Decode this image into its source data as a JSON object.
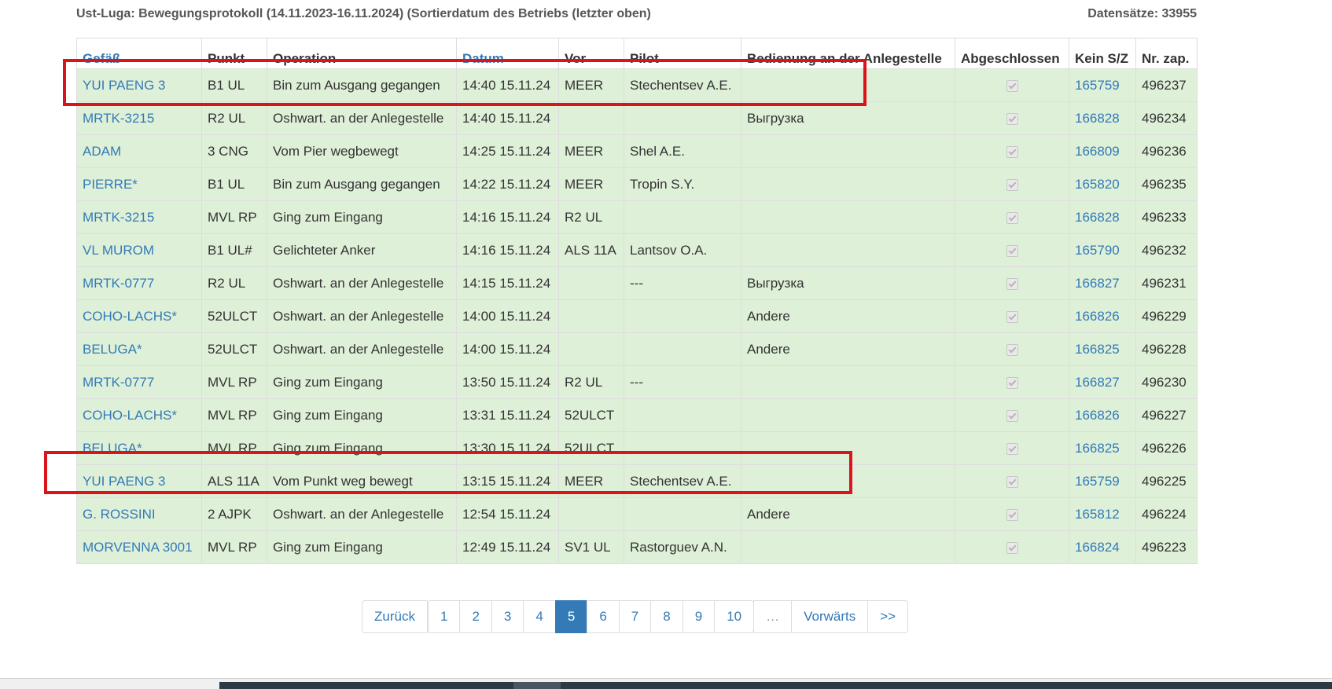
{
  "caption": {
    "title": "Ust-Luga: Bewegungsprotokoll (14.11.2023-16.11.2024) (Sortierdatum des Betriebs (letzter oben)",
    "count": "Datensätze: 33955"
  },
  "columns": {
    "vessel": "Gefäß",
    "point": "Punkt",
    "operation": "Operation",
    "date": "Datum",
    "from": "Vor",
    "pilot": "Pilot",
    "service": "Bedienung an der Anlegestelle",
    "completed": "Abgeschlossen",
    "sz": "Kein S/Z",
    "nr": "Nr. zap."
  },
  "rows": [
    {
      "vessel": "YUI PAENG 3",
      "point": "B1 UL",
      "operation": "Bin zum Ausgang gegangen",
      "date": "14:40 15.11.24",
      "from": "MEER",
      "pilot": "Stechentsev A.E.",
      "service": "",
      "sz": "165759",
      "nr": "496237"
    },
    {
      "vessel": "MRTK-3215",
      "point": "R2 UL",
      "operation": "Oshwart. an der Anlegestelle",
      "date": "14:40 15.11.24",
      "from": "",
      "pilot": "",
      "service": "Выгрузка",
      "sz": "166828",
      "nr": "496234"
    },
    {
      "vessel": "ADAM",
      "point": "3 CNG",
      "operation": "Vom Pier wegbewegt",
      "date": "14:25 15.11.24",
      "from": "MEER",
      "pilot": "Shel A.E.",
      "service": "",
      "sz": "166809",
      "nr": "496236"
    },
    {
      "vessel": "PIERRE*",
      "point": "B1 UL",
      "operation": "Bin zum Ausgang gegangen",
      "date": "14:22 15.11.24",
      "from": "MEER",
      "pilot": "Tropin S.Y.",
      "service": "",
      "sz": "165820",
      "nr": "496235"
    },
    {
      "vessel": "MRTK-3215",
      "point": "MVL RP",
      "operation": "Ging zum Eingang",
      "date": "14:16 15.11.24",
      "from": "R2 UL",
      "pilot": "",
      "service": "",
      "sz": "166828",
      "nr": "496233"
    },
    {
      "vessel": "VL MUROM",
      "point": "B1 UL#",
      "operation": "Gelichteter Anker",
      "date": "14:16 15.11.24",
      "from": "ALS 11A",
      "pilot": "Lantsov O.A.",
      "service": "",
      "sz": "165790",
      "nr": "496232"
    },
    {
      "vessel": "MRTK-0777",
      "point": "R2 UL",
      "operation": "Oshwart. an der Anlegestelle",
      "date": "14:15 15.11.24",
      "from": "",
      "pilot": "---",
      "service": "Выгрузка",
      "sz": "166827",
      "nr": "496231"
    },
    {
      "vessel": "COHO-LACHS*",
      "point": "52ULCT",
      "operation": "Oshwart. an der Anlegestelle",
      "date": "14:00 15.11.24",
      "from": "",
      "pilot": "",
      "service": "Andere",
      "sz": "166826",
      "nr": "496229"
    },
    {
      "vessel": "BELUGA*",
      "point": "52ULCT",
      "operation": "Oshwart. an der Anlegestelle",
      "date": "14:00 15.11.24",
      "from": "",
      "pilot": "",
      "service": "Andere",
      "sz": "166825",
      "nr": "496228"
    },
    {
      "vessel": "MRTK-0777",
      "point": "MVL RP",
      "operation": "Ging zum Eingang",
      "date": "13:50 15.11.24",
      "from": "R2 UL",
      "pilot": "---",
      "service": "",
      "sz": "166827",
      "nr": "496230"
    },
    {
      "vessel": "COHO-LACHS*",
      "point": "MVL RP",
      "operation": "Ging zum Eingang",
      "date": "13:31 15.11.24",
      "from": "52ULCT",
      "pilot": "",
      "service": "",
      "sz": "166826",
      "nr": "496227"
    },
    {
      "vessel": "BELUGA*",
      "point": "MVL RP",
      "operation": "Ging zum Eingang",
      "date": "13:30 15.11.24",
      "from": "52ULCT",
      "pilot": "",
      "service": "",
      "sz": "166825",
      "nr": "496226"
    },
    {
      "vessel": "YUI PAENG 3",
      "point": "ALS 11A",
      "operation": "Vom Punkt weg bewegt",
      "date": "13:15 15.11.24",
      "from": "MEER",
      "pilot": "Stechentsev A.E.",
      "service": "",
      "sz": "165759",
      "nr": "496225"
    },
    {
      "vessel": "G. ROSSINI",
      "point": "2 AJPK",
      "operation": "Oshwart. an der Anlegestelle",
      "date": "12:54 15.11.24",
      "from": "",
      "pilot": "",
      "service": "Andere",
      "sz": "165812",
      "nr": "496224"
    },
    {
      "vessel": "MORVENNA 3001",
      "point": "MVL RP",
      "operation": "Ging zum Eingang",
      "date": "12:49 15.11.24",
      "from": "SV1 UL",
      "pilot": "Rastorguev A.N.",
      "service": "",
      "sz": "166824",
      "nr": "496223"
    }
  ],
  "pagination": {
    "prev": "Zurück",
    "pages": [
      "1",
      "2",
      "3",
      "4",
      "5",
      "6",
      "7",
      "8",
      "9",
      "10"
    ],
    "current": "5",
    "ellipsis": "…",
    "next": "Vorwärts",
    "last": ">>"
  },
  "colors": {
    "row_bg": "#dff0d8",
    "link": "#337ab7",
    "highlight": "#d9141b"
  }
}
